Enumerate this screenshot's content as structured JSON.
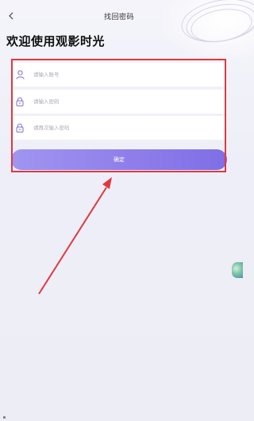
{
  "header": {
    "back_icon": "chevron-left-icon",
    "title": "找回密码"
  },
  "heading": "欢迎使用观影时光",
  "form": {
    "account": {
      "placeholder": "请输入账号",
      "value": "",
      "icon": "user-icon"
    },
    "password": {
      "placeholder": "请输入密码",
      "value": "",
      "icon": "lock-icon"
    },
    "password_confirm": {
      "placeholder": "请再次输入密码",
      "value": "",
      "icon": "lock-icon"
    },
    "confirm_label": "确定"
  },
  "colors": {
    "annotation_red": "#e0383e",
    "button_gradient_start": "#a095f0",
    "button_gradient_end": "#7f6ee6",
    "icon_purple": "#7d6ed8"
  }
}
